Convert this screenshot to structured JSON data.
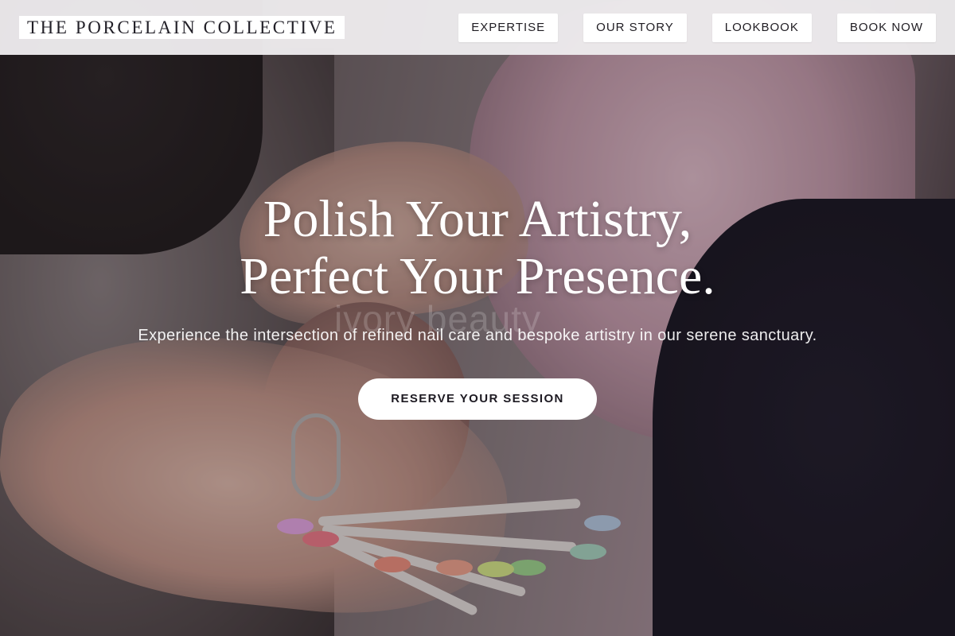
{
  "header": {
    "logo": "THE PORCELAIN COLLECTIVE",
    "nav": [
      {
        "label": "EXPERTISE"
      },
      {
        "label": "OUR STORY"
      },
      {
        "label": "LOOKBOOK"
      },
      {
        "label": "BOOK NOW"
      }
    ]
  },
  "hero": {
    "headline_line1": "Polish Your Artistry,",
    "headline_line2": "Perfect Your Presence.",
    "watermark": "ivory beauty",
    "subtext": "Experience the intersection of refined nail care and bespoke artistry in our serene sanctuary.",
    "cta_label": "RESERVE YOUR SESSION"
  },
  "colors": {
    "header_bg": "#eceaec",
    "text_dark": "#1f1c22",
    "button_bg": "#ffffff",
    "hero_text": "#ffffff"
  }
}
